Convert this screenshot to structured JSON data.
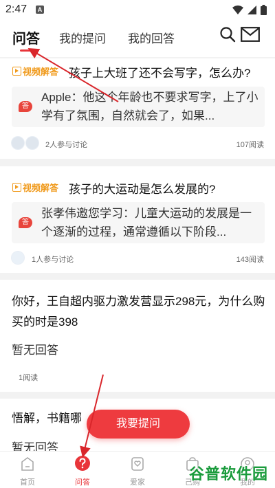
{
  "status": {
    "time": "2:47",
    "a_icon": "A"
  },
  "tabs": [
    {
      "label": "问答",
      "active": true
    },
    {
      "label": "我的提问"
    },
    {
      "label": "我的回答"
    }
  ],
  "icons": {
    "search": "search-icon",
    "mail": "mail-icon"
  },
  "badge_label": "视频解答",
  "answer_prefix": "答",
  "cards": [
    {
      "title": "孩子上大班了还不会写字，怎么办?",
      "answer": "Apple：他这个年龄也不要求写字，上了小学有了氛围，自然就会了，如果...",
      "participants": "2人参与讨论",
      "reads": "107阅读"
    },
    {
      "title": "孩子的大运动是怎么发展的?",
      "answer": "张孝伟邀您学习：儿童大运动的发展是一个逐渐的过程，通常遵循以下阶段...",
      "participants": "1人参与讨论",
      "reads": "143阅读"
    }
  ],
  "plain_cards": [
    {
      "title": "你好，王自超内驱力激发营显示298元，为什么购买的时是398",
      "status": "暂无回答",
      "reads": "1阅读"
    },
    {
      "title": "悟解，书籍哪",
      "status": "暂无回答"
    }
  ],
  "ask_button": "我要提问",
  "bottom_nav": [
    {
      "label": "首页"
    },
    {
      "label": "问答",
      "active": true
    },
    {
      "label": "爱家"
    },
    {
      "label": "己购"
    },
    {
      "label": "我的"
    }
  ],
  "watermark": "谷普软件园",
  "colors": {
    "accent": "#e8353a",
    "badge": "#f09a1c",
    "watermark": "#1a9b3c"
  }
}
